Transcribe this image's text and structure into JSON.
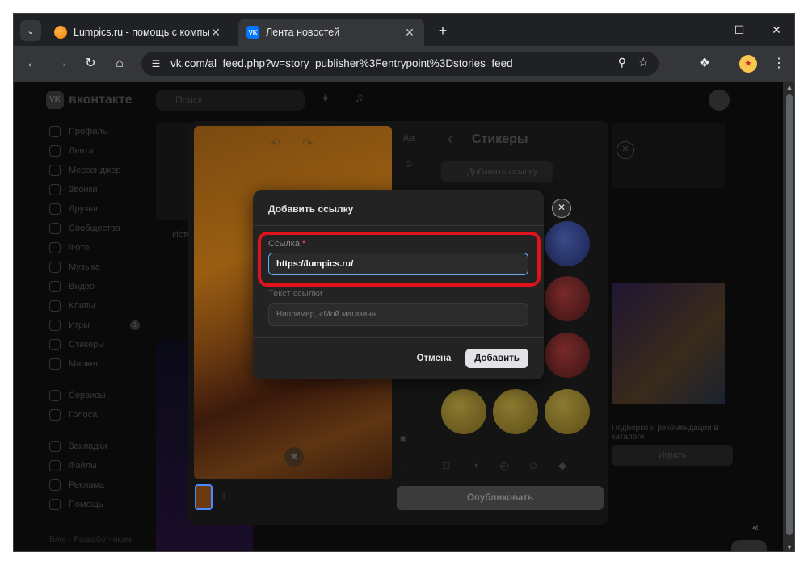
{
  "browser": {
    "tabs": [
      {
        "title": "Lumpics.ru - помощь с компьютером",
        "active": false
      },
      {
        "title": "Лента новостей",
        "active": true
      }
    ],
    "url": "vk.com/al_feed.php?w=story_publisher%3Fentrypoint%3Dstories_feed"
  },
  "vk": {
    "brand": "вконтакте",
    "search_placeholder": "Поиск",
    "nav": [
      "Профиль",
      "Лента",
      "Мессенджер",
      "Звонки",
      "Друзья",
      "Сообщества",
      "Фото",
      "Музыка",
      "Видео",
      "Клипы",
      "Игры",
      "Стикеры",
      "Маркет"
    ],
    "nav_games_badge": "1",
    "nav2": [
      "Сервисы",
      "Голоса"
    ],
    "nav3": [
      "Закладки",
      "Файлы",
      "Реклама",
      "Помощь"
    ],
    "footer": "Блог · Разработчикам",
    "stories_label": "Исто",
    "game_subtitle": "Подборки и рекомендации в каталоге",
    "game_button": "Играть"
  },
  "editor": {
    "stickers_title": "Стикеры",
    "add_link_button": "Добавить ссылку",
    "publish_button": "Опубликовать",
    "text_tool": "Aa"
  },
  "modal": {
    "title": "Добавить ссылку",
    "link_label": "Ссылка",
    "link_required_mark": "*",
    "link_value": "https://lumpics.ru/",
    "text_label": "Текст ссылки",
    "text_placeholder": "Например, «Мой магазин»",
    "cancel_button": "Отмена",
    "add_button": "Добавить"
  },
  "colors": {
    "highlight": "#e0121b",
    "focus_border": "#71aaeb",
    "modal_bg": "#232323"
  }
}
